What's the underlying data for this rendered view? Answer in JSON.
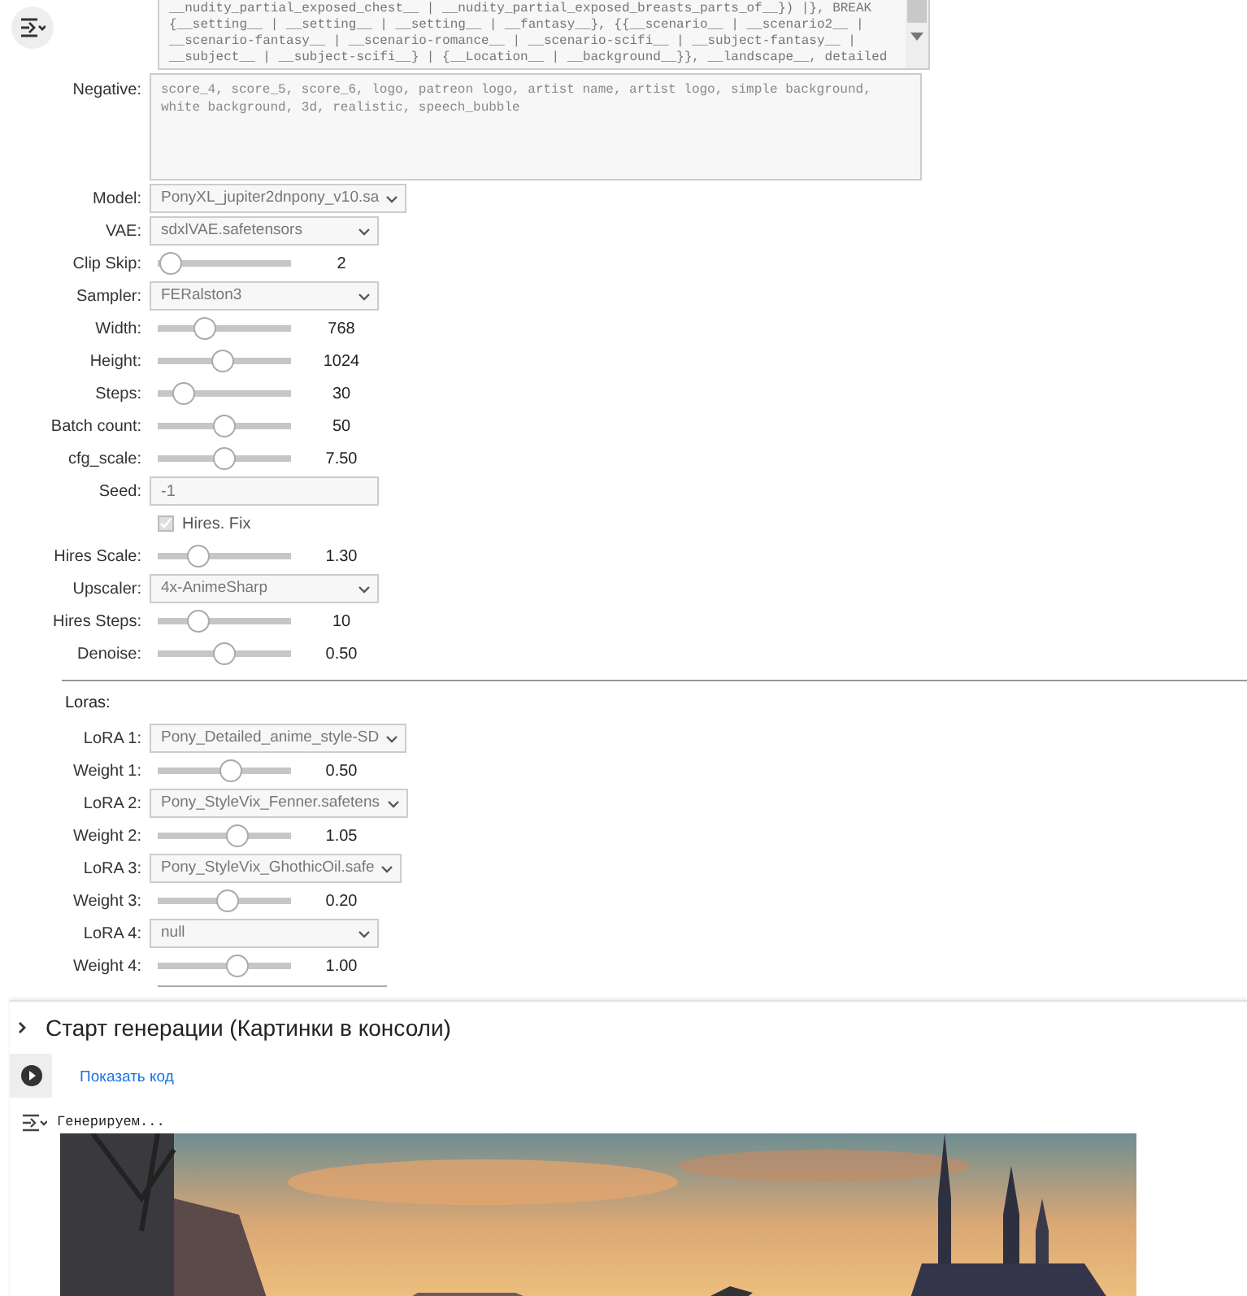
{
  "prompt_field": {
    "lines": [
      "__nudity_partial_exposed_chest__ | __nudity_partial_exposed_breasts_parts_of__}) |}, BREAK",
      "{__setting__ | __setting__ | __setting__ | __fantasy__}, {{__scenario__ | __scenario2__ |",
      "__scenario-fantasy__ | __scenario-romance__ | __scenario-scifi__ | __subject-fantasy__ |",
      "__subject__ | __subject-scifi__} | {__Location__ | __background__}}, __landscape__, detailed"
    ]
  },
  "negative": {
    "label": "Negative:",
    "text": "score_4, score_5, score_6, logo, patreon logo, artist name, artist logo, simple background, white background, 3d, realistic, speech_bubble"
  },
  "controls": [
    {
      "kind": "select",
      "label": "Model:",
      "value": "PonyXL_jupiter2dnpony_v10.sa"
    },
    {
      "kind": "select",
      "label": "VAE:",
      "value": "sdxlVAE.safetensors"
    },
    {
      "kind": "slider",
      "label": "Clip Skip:",
      "level": 0.1,
      "reading": "2"
    },
    {
      "kind": "select",
      "label": "Sampler:",
      "value": "FERalston3"
    },
    {
      "kind": "slider",
      "label": "Width:",
      "level": 0.35,
      "reading": "768"
    },
    {
      "kind": "slider",
      "label": "Height:",
      "level": 0.49,
      "reading": "1024"
    },
    {
      "kind": "slider",
      "label": "Steps:",
      "level": 0.2,
      "reading": "30"
    },
    {
      "kind": "slider",
      "label": "Batch count:",
      "level": 0.5,
      "reading": "50"
    },
    {
      "kind": "slider",
      "label": "cfg_scale:",
      "level": 0.5,
      "reading": "7.50"
    },
    {
      "kind": "text",
      "label": "Seed:",
      "value": "-1"
    },
    {
      "kind": "checkbox",
      "label": "Hires. Fix",
      "checked": true,
      "disabled": true
    },
    {
      "kind": "slider",
      "label": "Hires Scale:",
      "level": 0.3,
      "reading": "1.30"
    },
    {
      "kind": "select",
      "label": "Upscaler:",
      "value": "4x-AnimeSharp"
    },
    {
      "kind": "slider",
      "label": "Hires Steps:",
      "level": 0.3,
      "reading": "10"
    },
    {
      "kind": "slider",
      "label": "Denoise:",
      "level": 0.5,
      "reading": "0.50"
    }
  ],
  "loras": {
    "heading": "Loras:",
    "controls": [
      {
        "kind": "select",
        "label": "LoRA 1:",
        "value": "Pony_Detailed_anime_style-SD"
      },
      {
        "kind": "slider",
        "label": "Weight 1:",
        "level": 0.55,
        "reading": "0.50"
      },
      {
        "kind": "select",
        "label": "LoRA 2:",
        "value": "Pony_StyleVix_Fenner.safetens"
      },
      {
        "kind": "slider",
        "label": "Weight 2:",
        "level": 0.6,
        "reading": "1.05"
      },
      {
        "kind": "select",
        "label": "LoRA 3:",
        "value": "Pony_StyleVix_GhothicOil.safe"
      },
      {
        "kind": "slider",
        "label": "Weight 3:",
        "level": 0.52,
        "reading": "0.20"
      },
      {
        "kind": "select",
        "label": "LoRA 4:",
        "value": "null"
      },
      {
        "kind": "slider",
        "label": "Weight 4:",
        "level": 0.6,
        "reading": "1.00"
      }
    ]
  },
  "cell": {
    "title": "Старт генерации (Картинки в консоли)",
    "expanded": false,
    "show_code": "Показать код",
    "output_text": "Генерируем..."
  }
}
